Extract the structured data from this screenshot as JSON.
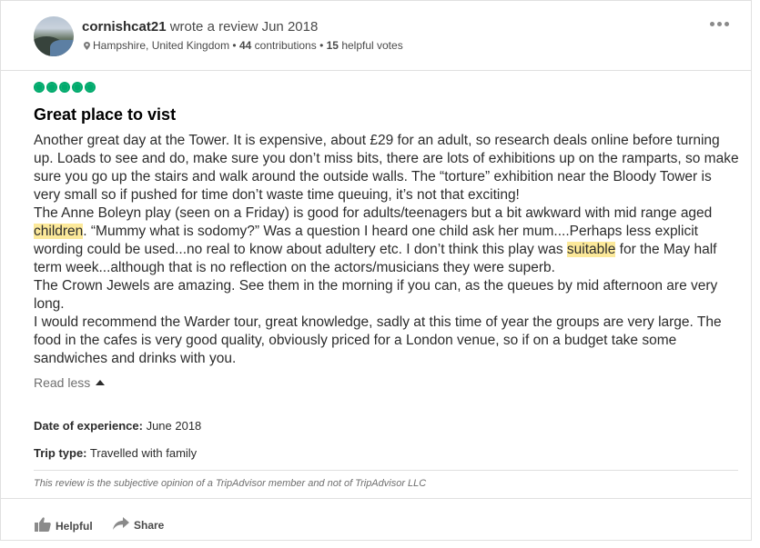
{
  "review": {
    "username": "cornishcat21",
    "action_text": "wrote a review Jun 2018",
    "location": "Hampshire, United Kingdom",
    "contributions_count": "44",
    "contributions_label": "contributions",
    "helpful_votes_count": "15",
    "helpful_votes_label": "helpful votes",
    "rating": 5,
    "rating_color": "#00aa6c",
    "title": "Great place to vist",
    "paragraphs": {
      "p1": "Another great day at the Tower. It is expensive, about £29 for an adult, so research deals online before turning up. Loads to see and do, make sure you don’t miss bits, there are lots of exhibitions up on the ramparts, so make sure you go up the stairs and walk around the outside walls. The “torture” exhibition near the Bloody Tower is very small so if pushed for time don’t waste time queuing, it’s not that exciting!",
      "p2a": "The Anne Boleyn play (seen on a Friday) is good for adults/teenagers but a bit awkward with mid range aged ",
      "p2_hl1": "children",
      "p2b": ". “Mummy what is sodomy?” Was a question I heard one child ask her mum....Perhaps less explicit wording could be used...no real to know about adultery etc. I don’t think this play was ",
      "p2_hl2": "suitable",
      "p2c": " for the May half term week...although that is no reflection on the actors/musicians they were superb.",
      "p3": "The Crown Jewels are amazing. See them in the morning if you can, as the queues by mid afternoon are very long.",
      "p4": "I would recommend the Warder tour, great knowledge, sadly at this time of year the groups are very large. The food in the cafes is very good quality, obviously priced for a London venue, so if on a budget take some sandwiches and drinks with you."
    },
    "highlight_color": "#fce99a",
    "read_less_label": "Read less",
    "date_label": "Date of experience:",
    "date_value": "June 2018",
    "trip_label": "Trip type:",
    "trip_value": "Travelled with family",
    "disclaimer": "This review is the subjective opinion of a TripAdvisor member and not of TripAdvisor LLC",
    "helpful_label": "Helpful",
    "share_label": "Share",
    "icons": [
      "more-options-icon",
      "location-pin-icon",
      "rating-bubble-icon",
      "caret-up-icon",
      "thumbs-up-icon",
      "share-arrow-icon"
    ]
  }
}
